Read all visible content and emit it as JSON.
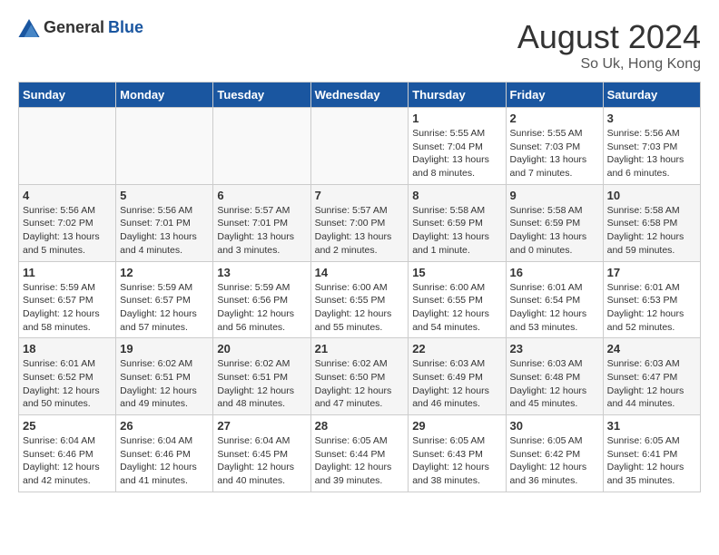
{
  "header": {
    "logo_general": "General",
    "logo_blue": "Blue",
    "month_year": "August 2024",
    "location": "So Uk, Hong Kong"
  },
  "days_of_week": [
    "Sunday",
    "Monday",
    "Tuesday",
    "Wednesday",
    "Thursday",
    "Friday",
    "Saturday"
  ],
  "weeks": [
    {
      "days": [
        {
          "num": "",
          "content": ""
        },
        {
          "num": "",
          "content": ""
        },
        {
          "num": "",
          "content": ""
        },
        {
          "num": "",
          "content": ""
        },
        {
          "num": "1",
          "content": "Sunrise: 5:55 AM\nSunset: 7:04 PM\nDaylight: 13 hours\nand 8 minutes."
        },
        {
          "num": "2",
          "content": "Sunrise: 5:55 AM\nSunset: 7:03 PM\nDaylight: 13 hours\nand 7 minutes."
        },
        {
          "num": "3",
          "content": "Sunrise: 5:56 AM\nSunset: 7:03 PM\nDaylight: 13 hours\nand 6 minutes."
        }
      ]
    },
    {
      "days": [
        {
          "num": "4",
          "content": "Sunrise: 5:56 AM\nSunset: 7:02 PM\nDaylight: 13 hours\nand 5 minutes."
        },
        {
          "num": "5",
          "content": "Sunrise: 5:56 AM\nSunset: 7:01 PM\nDaylight: 13 hours\nand 4 minutes."
        },
        {
          "num": "6",
          "content": "Sunrise: 5:57 AM\nSunset: 7:01 PM\nDaylight: 13 hours\nand 3 minutes."
        },
        {
          "num": "7",
          "content": "Sunrise: 5:57 AM\nSunset: 7:00 PM\nDaylight: 13 hours\nand 2 minutes."
        },
        {
          "num": "8",
          "content": "Sunrise: 5:58 AM\nSunset: 6:59 PM\nDaylight: 13 hours\nand 1 minute."
        },
        {
          "num": "9",
          "content": "Sunrise: 5:58 AM\nSunset: 6:59 PM\nDaylight: 13 hours\nand 0 minutes."
        },
        {
          "num": "10",
          "content": "Sunrise: 5:58 AM\nSunset: 6:58 PM\nDaylight: 12 hours\nand 59 minutes."
        }
      ]
    },
    {
      "days": [
        {
          "num": "11",
          "content": "Sunrise: 5:59 AM\nSunset: 6:57 PM\nDaylight: 12 hours\nand 58 minutes."
        },
        {
          "num": "12",
          "content": "Sunrise: 5:59 AM\nSunset: 6:57 PM\nDaylight: 12 hours\nand 57 minutes."
        },
        {
          "num": "13",
          "content": "Sunrise: 5:59 AM\nSunset: 6:56 PM\nDaylight: 12 hours\nand 56 minutes."
        },
        {
          "num": "14",
          "content": "Sunrise: 6:00 AM\nSunset: 6:55 PM\nDaylight: 12 hours\nand 55 minutes."
        },
        {
          "num": "15",
          "content": "Sunrise: 6:00 AM\nSunset: 6:55 PM\nDaylight: 12 hours\nand 54 minutes."
        },
        {
          "num": "16",
          "content": "Sunrise: 6:01 AM\nSunset: 6:54 PM\nDaylight: 12 hours\nand 53 minutes."
        },
        {
          "num": "17",
          "content": "Sunrise: 6:01 AM\nSunset: 6:53 PM\nDaylight: 12 hours\nand 52 minutes."
        }
      ]
    },
    {
      "days": [
        {
          "num": "18",
          "content": "Sunrise: 6:01 AM\nSunset: 6:52 PM\nDaylight: 12 hours\nand 50 minutes."
        },
        {
          "num": "19",
          "content": "Sunrise: 6:02 AM\nSunset: 6:51 PM\nDaylight: 12 hours\nand 49 minutes."
        },
        {
          "num": "20",
          "content": "Sunrise: 6:02 AM\nSunset: 6:51 PM\nDaylight: 12 hours\nand 48 minutes."
        },
        {
          "num": "21",
          "content": "Sunrise: 6:02 AM\nSunset: 6:50 PM\nDaylight: 12 hours\nand 47 minutes."
        },
        {
          "num": "22",
          "content": "Sunrise: 6:03 AM\nSunset: 6:49 PM\nDaylight: 12 hours\nand 46 minutes."
        },
        {
          "num": "23",
          "content": "Sunrise: 6:03 AM\nSunset: 6:48 PM\nDaylight: 12 hours\nand 45 minutes."
        },
        {
          "num": "24",
          "content": "Sunrise: 6:03 AM\nSunset: 6:47 PM\nDaylight: 12 hours\nand 44 minutes."
        }
      ]
    },
    {
      "days": [
        {
          "num": "25",
          "content": "Sunrise: 6:04 AM\nSunset: 6:46 PM\nDaylight: 12 hours\nand 42 minutes."
        },
        {
          "num": "26",
          "content": "Sunrise: 6:04 AM\nSunset: 6:46 PM\nDaylight: 12 hours\nand 41 minutes."
        },
        {
          "num": "27",
          "content": "Sunrise: 6:04 AM\nSunset: 6:45 PM\nDaylight: 12 hours\nand 40 minutes."
        },
        {
          "num": "28",
          "content": "Sunrise: 6:05 AM\nSunset: 6:44 PM\nDaylight: 12 hours\nand 39 minutes."
        },
        {
          "num": "29",
          "content": "Sunrise: 6:05 AM\nSunset: 6:43 PM\nDaylight: 12 hours\nand 38 minutes."
        },
        {
          "num": "30",
          "content": "Sunrise: 6:05 AM\nSunset: 6:42 PM\nDaylight: 12 hours\nand 36 minutes."
        },
        {
          "num": "31",
          "content": "Sunrise: 6:05 AM\nSunset: 6:41 PM\nDaylight: 12 hours\nand 35 minutes."
        }
      ]
    }
  ]
}
